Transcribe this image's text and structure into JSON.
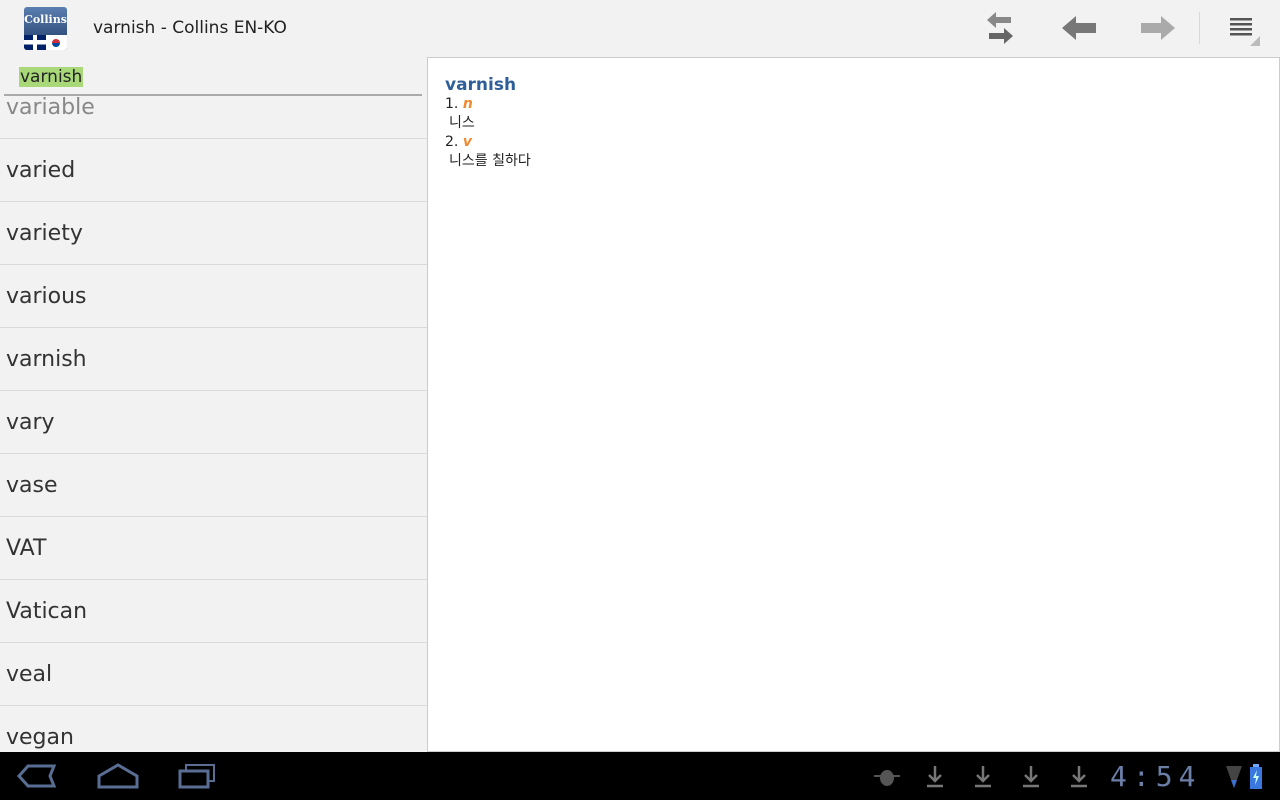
{
  "actionbar": {
    "logo_text": "Collins",
    "title": "varnish - Collins EN-KO",
    "icons": [
      "swap-languages-icon",
      "back-arrow-icon",
      "forward-arrow-icon",
      "overflow-menu-icon"
    ]
  },
  "search": {
    "value": "varnish"
  },
  "word_list": [
    "variable",
    "varied",
    "variety",
    "various",
    "varnish",
    "vary",
    "vase",
    "VAT",
    "Vatican",
    "veal",
    "vegan"
  ],
  "entry": {
    "headword": "varnish",
    "senses": [
      {
        "num": "1.",
        "pos": "n",
        "translation": "니스"
      },
      {
        "num": "2.",
        "pos": "v",
        "translation": "니스를 칠하다"
      }
    ]
  },
  "status_bar": {
    "time": "4:54",
    "icons": [
      "debug-icon",
      "download-icon",
      "download-icon",
      "download-icon",
      "download-icon",
      "wifi-icon",
      "battery-charging-icon"
    ]
  },
  "colors": {
    "headword": "#2f5f98",
    "pos": "#f08a30",
    "search_highlight": "#a8d878"
  }
}
